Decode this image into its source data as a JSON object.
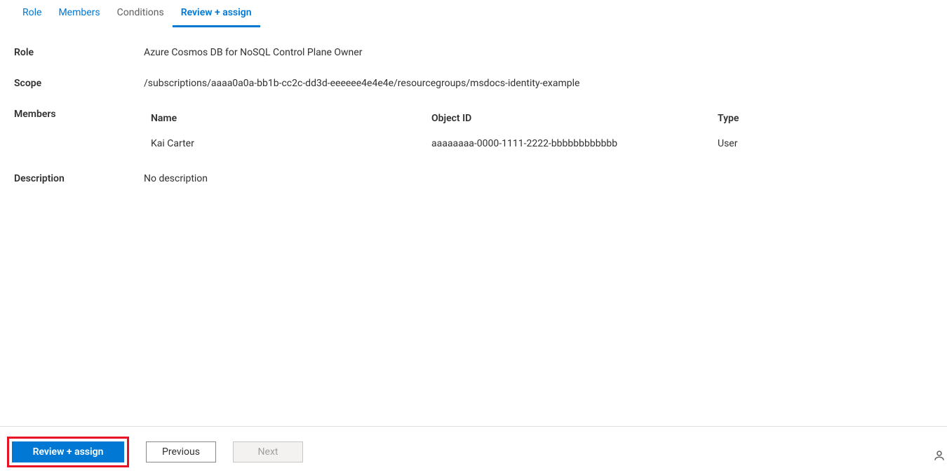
{
  "tabs": {
    "role": "Role",
    "members": "Members",
    "conditions": "Conditions",
    "review": "Review + assign"
  },
  "labels": {
    "role": "Role",
    "scope": "Scope",
    "members": "Members",
    "description": "Description"
  },
  "values": {
    "role": "Azure Cosmos DB for NoSQL Control Plane Owner",
    "scope": "/subscriptions/aaaa0a0a-bb1b-cc2c-dd3d-eeeeee4e4e4e/resourcegroups/msdocs-identity-example",
    "description": "No description"
  },
  "membersTable": {
    "headers": {
      "name": "Name",
      "objectId": "Object ID",
      "type": "Type"
    },
    "rows": [
      {
        "name": "Kai Carter",
        "objectId": "aaaaaaaa-0000-1111-2222-bbbbbbbbbbbb",
        "type": "User"
      }
    ]
  },
  "footer": {
    "reviewAssign": "Review + assign",
    "previous": "Previous",
    "next": "Next"
  }
}
